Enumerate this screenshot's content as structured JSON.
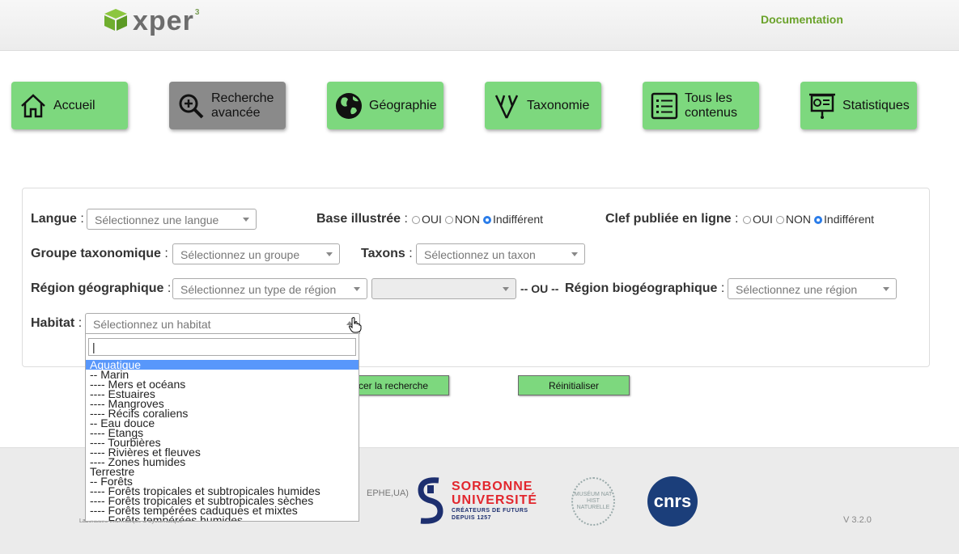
{
  "header": {
    "logo_text": "xper",
    "logo_sup": "3",
    "documentation_link": "Documentation"
  },
  "nav": [
    {
      "label": "Accueil",
      "icon": "home-icon"
    },
    {
      "label": "Recherche avancée",
      "icon": "search-plus-icon",
      "active": true
    },
    {
      "label": "Géographie",
      "icon": "globe-icon"
    },
    {
      "label": "Taxonomie",
      "icon": "taxonomy-tree-icon"
    },
    {
      "label": "Tous les contenus",
      "icon": "list-icon"
    },
    {
      "label": "Statistiques",
      "icon": "presentation-chart-icon"
    }
  ],
  "form": {
    "langue": {
      "label": "Langue",
      "placeholder": "Sélectionnez une langue"
    },
    "base_illustree": {
      "label": "Base illustrée",
      "options": [
        "OUI",
        "NON",
        "Indifférent"
      ],
      "selected": "Indifférent"
    },
    "clef_publiee": {
      "label": "Clef publiée en ligne",
      "options": [
        "OUI",
        "NON",
        "Indifférent"
      ],
      "selected": "Indifférent"
    },
    "groupe": {
      "label": "Groupe taxonomique",
      "placeholder": "Sélectionnez un groupe"
    },
    "taxons": {
      "label": "Taxons",
      "placeholder": "Sélectionnez un taxon"
    },
    "region_geo": {
      "label": "Région géographique",
      "placeholder": "Sélectionnez un type de région",
      "sub_value": ""
    },
    "separator": "-- OU --",
    "region_bio": {
      "label": "Région biogéographique",
      "placeholder": "Sélectionnez une région"
    },
    "habitat": {
      "label": "Habitat",
      "placeholder": "Sélectionnez un habitat"
    }
  },
  "actions": {
    "search_label": "cer la recherche",
    "reset_label": "Réinitialiser"
  },
  "habitat_dropdown": {
    "search_value": "",
    "highlighted": "Aquatique",
    "items": [
      "Aquatique",
      "-- Marin",
      "---- Mers et océans",
      "---- Estuaires",
      "---- Mangroves",
      "---- Récifs coraliens",
      "-- Eau douce",
      "---- Etangs",
      "---- Tourbières",
      "---- Rivières et fleuves",
      "---- Zones humides",
      "Terrestre",
      "-- Forêts",
      "---- Forêts tropicales et subtropicales humides",
      "---- Forêts tropicales et subtropicales sèches",
      "---- Forêts tempérées caduques et mixtes",
      "---- Forêts tempérées humides"
    ]
  },
  "footer": {
    "partner_text": "EPHE,UA)",
    "lab_text": "Laboratoire Informatique & Systématique",
    "sorbonne_line1": "SORBONNE",
    "sorbonne_line2": "UNIVERSITÉ",
    "sorbonne_tag1": "CRÉATEURS DE FUTURS",
    "sorbonne_tag2": "DEPUIS 1257",
    "museum_text": "MUSÉUM NAT HIST NATURELLE",
    "cnrs_text": "cnrs",
    "version": "V 3.2.0"
  }
}
